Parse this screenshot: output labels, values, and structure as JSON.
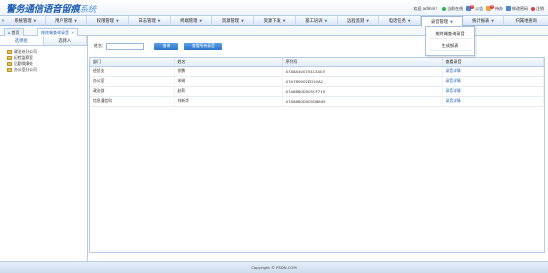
{
  "header": {
    "logo_main": "警务通信语音留痕",
    "logo_sub": "系统",
    "welcome": "欢迎 admin！",
    "online_status": "当前在线",
    "notice_label": "公告",
    "notice_count": "0",
    "todo_label": "待办",
    "todo_count": "0",
    "change_password": "修改密码",
    "logout": "注销",
    "colors": {
      "logo": "#1f5fb0",
      "online_dot": "#2fb344",
      "logout_dot": "#e23b3b"
    }
  },
  "menu": {
    "items": [
      {
        "label": "系统管理"
      },
      {
        "label": "用户管理"
      },
      {
        "label": "权限管理"
      },
      {
        "label": "日志管理"
      },
      {
        "label": "终端管理"
      },
      {
        "label": "资源管理"
      },
      {
        "label": "资源下发"
      },
      {
        "label": "基工培训"
      },
      {
        "label": "远程监测"
      },
      {
        "label": "电话任务"
      },
      {
        "label": "录音管理"
      },
      {
        "label": "统计报表"
      },
      {
        "label": "归属地查询"
      }
    ],
    "dropdown": [
      "按终端查询录音",
      "生成报表"
    ]
  },
  "tabs": [
    {
      "label": "首页"
    },
    {
      "label": "按终端查询录音"
    }
  ],
  "left_panel": {
    "tabs": [
      "选择组",
      "选择人"
    ],
    "tree": [
      "政治处分公司",
      "纪检监察室",
      "后勤保障处",
      "办公室分公司"
    ]
  },
  "search": {
    "label": "姓名:",
    "value": "",
    "query_button": "查询",
    "view_all_button": "查看所有录音"
  },
  "table": {
    "headers": [
      "部门",
      "姓名",
      "序列号",
      "查看录音"
    ],
    "rows": [
      [
        "经侦支",
        "徐鹏",
        "X7A8A40070413A03",
        "录音详情"
      ],
      [
        "办公室",
        "宋琳",
        "X7A7B9002ED10A2",
        "录音详情"
      ],
      [
        "政治部",
        "赵莉",
        "X7A8880D005CF719",
        "录音详情"
      ],
      [
        "信息通信科",
        "刘新华",
        "X7A8880D005D8805",
        "录音详情"
      ]
    ]
  },
  "footer": {
    "copyright": "Copyright © PSDN.COM"
  }
}
